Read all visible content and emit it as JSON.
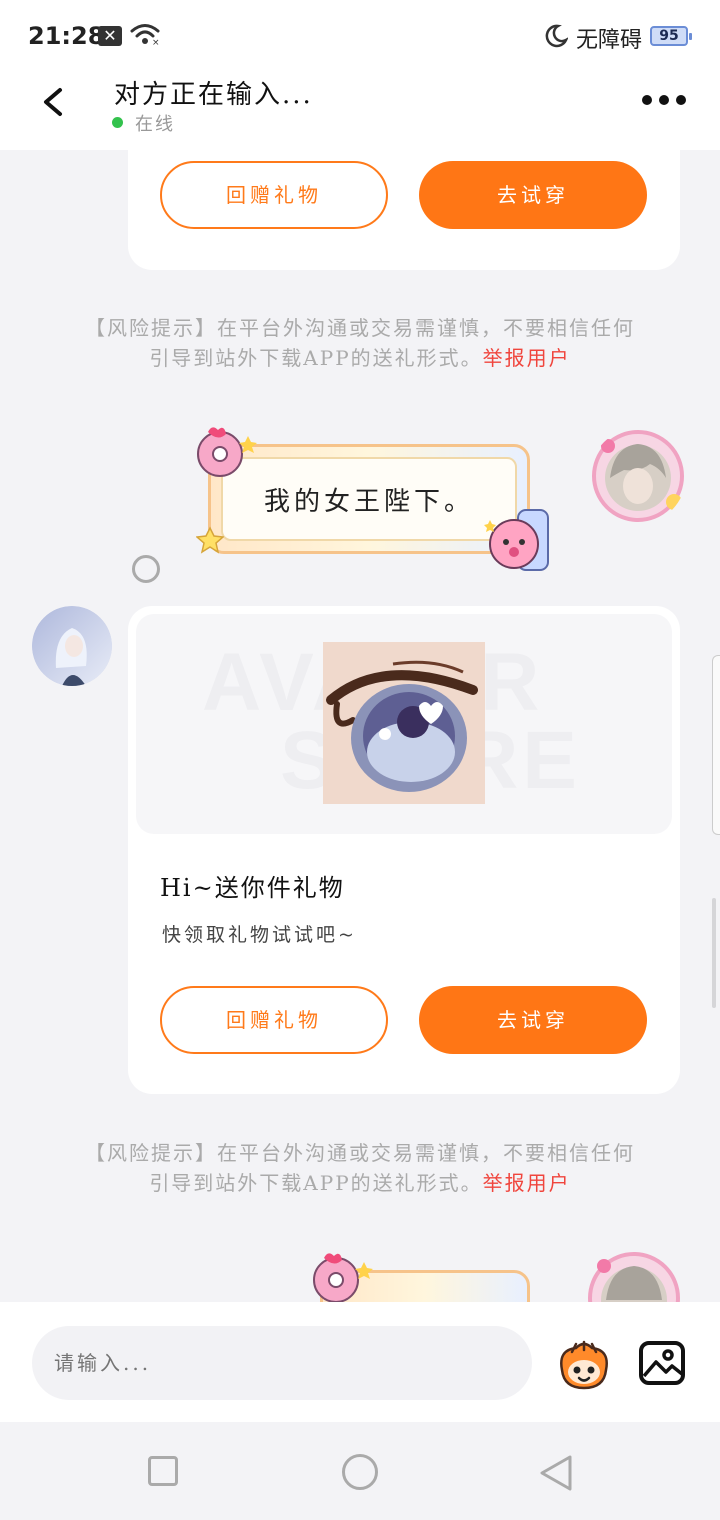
{
  "status_bar": {
    "time": "21:28",
    "notification_badge": "✕",
    "accessibility_label": "无障碍",
    "battery_level": "95",
    "icons": [
      "x-notification-icon",
      "wifi-icon",
      "moon-icon",
      "battery-icon"
    ]
  },
  "header": {
    "title": "对方正在输入...",
    "status": "在线",
    "icons": [
      "back-arrow-icon",
      "more-options-icon"
    ]
  },
  "messages": [
    {
      "type": "gift_card_partial",
      "secondary_button": "回赠礼物",
      "primary_button": "去试穿"
    },
    {
      "type": "risk_notice",
      "text_line1": "【风险提示】在平台外沟通或交易需谨慎，不要相信任何",
      "text_line2": "引导到站外下载APP的送礼形式。",
      "report_link": "举报用户"
    },
    {
      "type": "sticker_bubble",
      "sender": "me",
      "text": "我的女王陛下。"
    },
    {
      "type": "gift_card",
      "sender": "other",
      "preview_watermark_top": "AVATAR",
      "preview_watermark_bottom": "STORE",
      "title": "Hi~送你件礼物",
      "subtitle": "快领取礼物试试吧~",
      "secondary_button": "回赠礼物",
      "primary_button": "去试穿"
    },
    {
      "type": "risk_notice",
      "text_line1": "【风险提示】在平台外沟通或交易需谨慎，不要相信任何",
      "text_line2": "引导到站外下载APP的送礼形式。",
      "report_link": "举报用户"
    },
    {
      "type": "sticker_bubble_partial",
      "sender": "me"
    }
  ],
  "input_bar": {
    "placeholder": "请输入...",
    "icons": [
      "emoji-sticker-icon",
      "image-picker-icon"
    ]
  },
  "nav_bar": {
    "icons": [
      "recent-apps-icon",
      "home-icon",
      "back-icon"
    ]
  },
  "colors": {
    "accent": "#ff7615",
    "report": "#f0453d",
    "online": "#33c24d",
    "background": "#f3f3f6"
  }
}
